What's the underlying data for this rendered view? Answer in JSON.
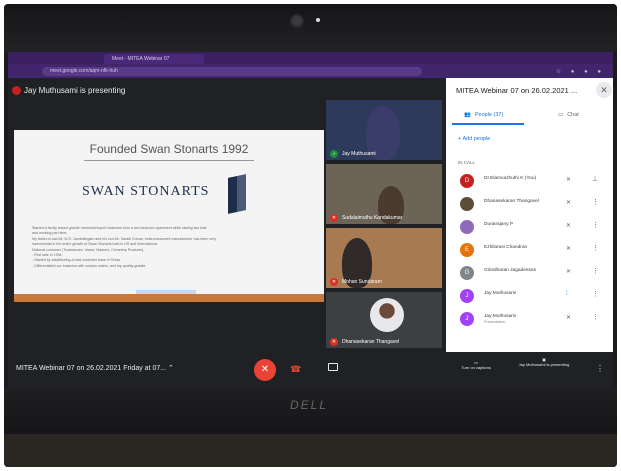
{
  "browser": {
    "tab_title": "Meet - MITEA Webinar 07",
    "url": "meet.google.com/aqm-nfk-huh"
  },
  "meet": {
    "presenting_text": "Jay Muthusami is presenting",
    "meeting_title": "MITEA Webinar 07 on 26.02.2021 Friday at 07...",
    "slide": {
      "title": "Founded Swan Stonarts 1992",
      "logo_text": "SWAN STONARTS",
      "lines": [
        "Started a family based granite memorial import business from a two bedroom apartment while raising two kids",
        "and working part time.",
        "My father-in-law Mr. M.S. Jambulingam and his son Mr. Sarath Kumar, India monument manufacturer has been very",
        "instrumental in the entire growth of Swan Stonarts both in US and International.",
        "National customer (Tombstones, Vases, Markers, Cemetery Products).",
        "- First sale in 1994.",
        "- Started by establishing a total customer base in Texas.",
        "- Differentiated our business with custom orders, and top quality granite."
      ]
    },
    "tiles": [
      {
        "name": "Jay Muthusami"
      },
      {
        "name": "Sudalaimuthu Kandakumar"
      },
      {
        "name": "Mohan Sundaram"
      },
      {
        "name": "Dhanasekaran Thangavel"
      }
    ]
  },
  "panel": {
    "title": "MITEA Webinar 07 on 26.02.2021 ...",
    "people_tab": "People (37)",
    "chat_tab": "Chat",
    "add_people": "Add people",
    "in_call": "IN CALL",
    "participants": [
      {
        "name": "Dr.Elamvazhuthi K (You)",
        "initial": "D",
        "color": "#c5221f"
      },
      {
        "name": "Dhanasekaran Thangavel",
        "initial": "",
        "color": "#5d4e37"
      },
      {
        "name": "Durairajany P",
        "initial": "",
        "color": "#8e6bb8"
      },
      {
        "name": "Ezhilarasi Chandran",
        "initial": "E",
        "color": "#e8710a"
      },
      {
        "name": "Girisdharan Jagadeesan",
        "initial": "G",
        "color": "#80868b"
      },
      {
        "name": "Jay Muthusami",
        "initial": "J",
        "color": "#a142f4"
      },
      {
        "name": "Jay Muthusami",
        "sub": "Presentation",
        "initial": "J",
        "color": "#a142f4"
      }
    ],
    "turn_on_captions": "Turn on captions",
    "presenting_label": "Jay Muthusami is presenting"
  },
  "laptop": {
    "brand": "DELL"
  }
}
